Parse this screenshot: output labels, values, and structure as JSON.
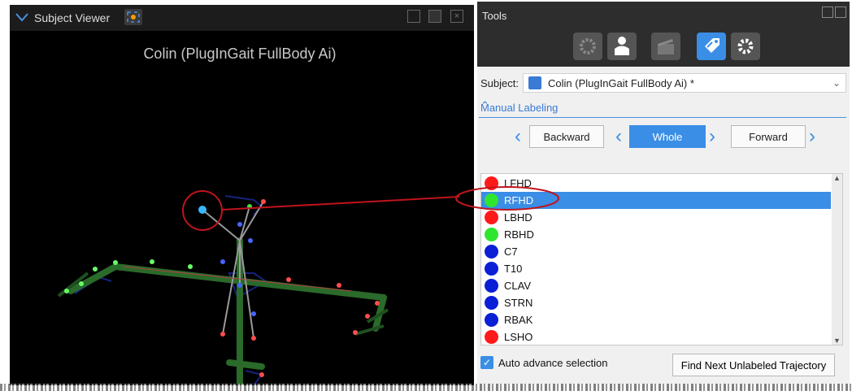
{
  "viewer": {
    "title": "Subject Viewer",
    "subject_name": "Colin (PlugInGait FullBody Ai)"
  },
  "tools": {
    "title": "Tools",
    "icons": [
      "target-icon",
      "person-icon",
      "clapper-icon",
      "label-tag-icon",
      "gear-icon"
    ],
    "active_icon": "label-tag-icon",
    "subject_label": "Subject:",
    "subject_value": "Colin (PlugInGait FullBody Ai) *",
    "section_title": "Manual Labeling",
    "nav": {
      "backward": "Backward",
      "whole": "Whole",
      "forward": "Forward"
    },
    "markers": [
      {
        "name": "LFHD",
        "color": "#ff1a1a"
      },
      {
        "name": "RFHD",
        "color": "#2ee62e",
        "selected": true
      },
      {
        "name": "LBHD",
        "color": "#ff1a1a"
      },
      {
        "name": "RBHD",
        "color": "#2ee62e"
      },
      {
        "name": "C7",
        "color": "#0b1fd6"
      },
      {
        "name": "T10",
        "color": "#0b1fd6"
      },
      {
        "name": "CLAV",
        "color": "#0b1fd6"
      },
      {
        "name": "STRN",
        "color": "#0b1fd6"
      },
      {
        "name": "RBAK",
        "color": "#0b1fd6"
      },
      {
        "name": "LSHO",
        "color": "#ff1a1a"
      }
    ],
    "auto_advance_label": "Auto advance selection",
    "auto_advance_checked": true,
    "find_next_label": "Find Next Unlabeled Trajectory"
  },
  "colors": {
    "accent": "#3a8ee6",
    "callout": "#c0141c"
  }
}
